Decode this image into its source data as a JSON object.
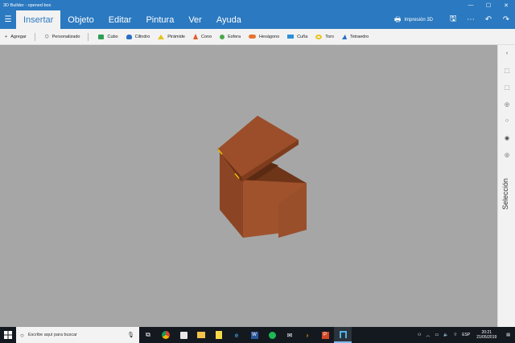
{
  "window": {
    "title": "3D Builder - opened box",
    "controls": [
      "—",
      "☐",
      "✕"
    ]
  },
  "menu": {
    "tabs": [
      "Insertar",
      "Objeto",
      "Editar",
      "Pintura",
      "Ver",
      "Ayuda"
    ],
    "active": "Insertar",
    "print_label": "Impresión 3D"
  },
  "toolbar": {
    "add_label": "Agregar",
    "custom_label": "Personalizado",
    "shapes": [
      {
        "label": "Cubo",
        "icon": "cube-icon",
        "color": "#2f9e57"
      },
      {
        "label": "Cilindro",
        "icon": "cylinder-icon",
        "color": "#2a6dc4"
      },
      {
        "label": "Pirámide",
        "icon": "pyramid-icon",
        "color": "#e3c21a"
      },
      {
        "label": "Cono",
        "icon": "cone-icon",
        "color": "#e05a2b"
      },
      {
        "label": "Esfera",
        "icon": "sphere-icon",
        "color": "#4aa84a"
      },
      {
        "label": "Hexágono",
        "icon": "hexagon-icon",
        "color": "#e5742d"
      },
      {
        "label": "Cuña",
        "icon": "wedge-icon",
        "color": "#2f8fd8"
      },
      {
        "label": "Toro",
        "icon": "torus-icon",
        "color": "#e9c41c"
      },
      {
        "label": "Tetraedro",
        "icon": "tetrahedron-icon",
        "color": "#2a6dc4"
      }
    ]
  },
  "side_panel": {
    "label": "Selección"
  },
  "model": {
    "color": "#a0522d",
    "description_color_dark": "#7a3d1f"
  },
  "taskbar": {
    "search_placeholder": "Escribe aquí para buscar",
    "language": "ESP",
    "time": "20:21",
    "date": "21/05/2019"
  }
}
